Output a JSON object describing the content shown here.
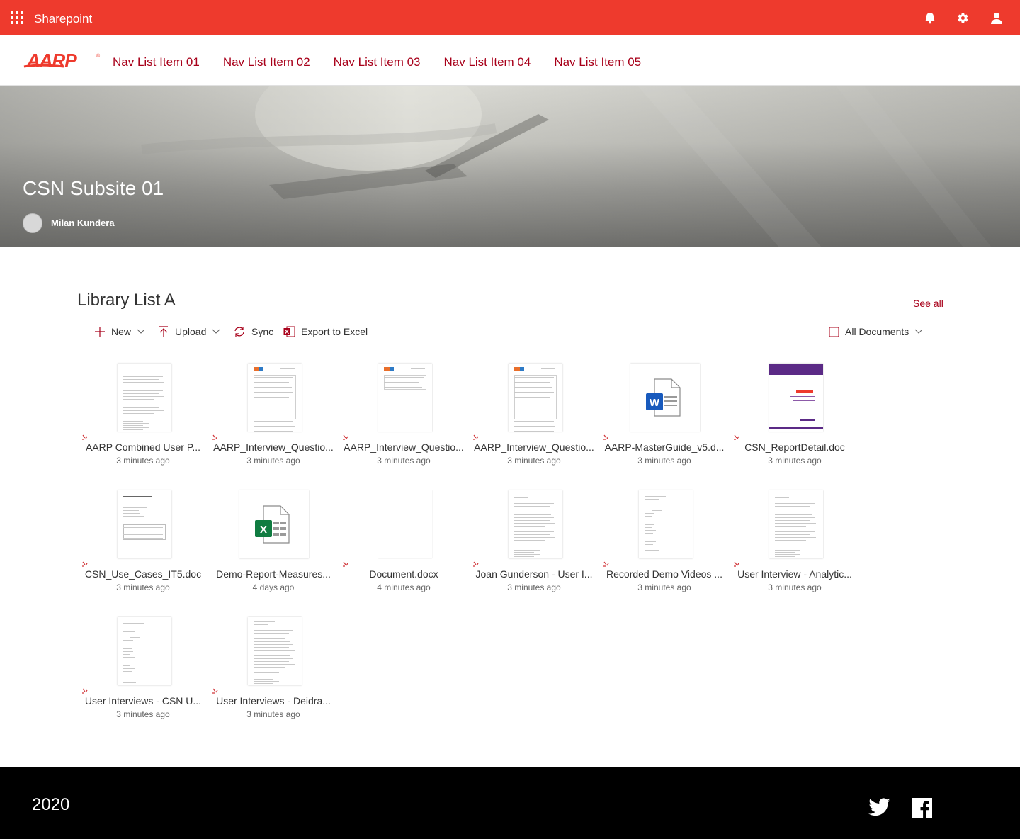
{
  "suite": {
    "title": "Sharepoint",
    "icons": [
      "bell-icon",
      "gear-icon",
      "person-icon"
    ]
  },
  "brand": {
    "logo_text": "AARP",
    "accent": "#ee3a2d",
    "link_color": "#a8001a"
  },
  "nav": {
    "items": [
      {
        "label": "Nav List Item 01"
      },
      {
        "label": "Nav List Item 02"
      },
      {
        "label": "Nav List Item 03"
      },
      {
        "label": "Nav List Item 04"
      },
      {
        "label": "Nav List Item 05"
      }
    ]
  },
  "hero": {
    "title": "CSN Subsite 01",
    "author": "Milan Kundera"
  },
  "library": {
    "title": "Library List A",
    "see_all": "See all",
    "commands": {
      "new": "New",
      "upload": "Upload",
      "sync": "Sync",
      "export": "Export to Excel",
      "view": "All Documents"
    },
    "files": [
      {
        "name": "AARP Combined User P...",
        "time": "3 minutes ago",
        "thumb": "doc-text",
        "is_new": true
      },
      {
        "name": "AARP_Interview_Questio...",
        "time": "3 minutes ago",
        "thumb": "doc-form",
        "is_new": true
      },
      {
        "name": "AARP_Interview_Questio...",
        "time": "3 minutes ago",
        "thumb": "doc-form-short",
        "is_new": true
      },
      {
        "name": "AARP_Interview_Questio...",
        "time": "3 minutes ago",
        "thumb": "doc-form",
        "is_new": true
      },
      {
        "name": "AARP-MasterGuide_v5.d...",
        "time": "3 minutes ago",
        "thumb": "word-icon",
        "is_new": true
      },
      {
        "name": "CSN_ReportDetail.doc",
        "time": "3 minutes ago",
        "thumb": "doc-cover",
        "is_new": true
      },
      {
        "name": "CSN_Use_Cases_IT5.doc",
        "time": "3 minutes ago",
        "thumb": "doc-table",
        "is_new": true
      },
      {
        "name": "Demo-Report-Measures...",
        "time": "4 days ago",
        "thumb": "excel-icon",
        "is_new": false
      },
      {
        "name": "Document.docx",
        "time": "4 minutes ago",
        "thumb": "doc-blank",
        "is_new": true
      },
      {
        "name": "Joan Gunderson - User I...",
        "time": "3 minutes ago",
        "thumb": "doc-text",
        "is_new": true
      },
      {
        "name": "Recorded Demo Videos ...",
        "time": "3 minutes ago",
        "thumb": "doc-list",
        "is_new": true
      },
      {
        "name": "User Interview - Analytic...",
        "time": "3 minutes ago",
        "thumb": "doc-text",
        "is_new": true
      },
      {
        "name": "User Interviews - CSN U...",
        "time": "3 minutes ago",
        "thumb": "doc-list",
        "is_new": true
      },
      {
        "name": "User Interviews - Deidra...",
        "time": "3 minutes ago",
        "thumb": "doc-text",
        "is_new": true
      }
    ]
  },
  "footer": {
    "year": "2020",
    "icons": [
      "twitter-icon",
      "facebook-icon"
    ]
  }
}
